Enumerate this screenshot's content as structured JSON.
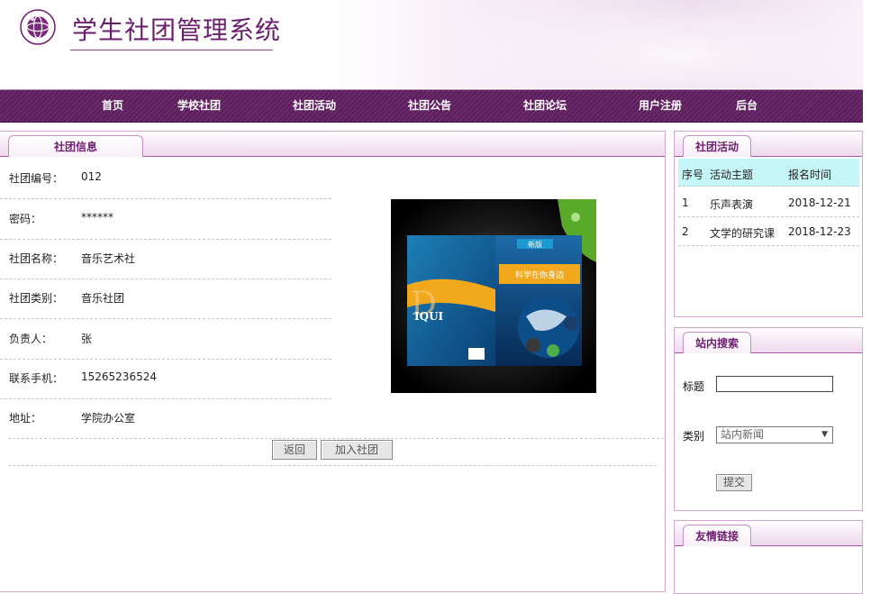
{
  "header": {
    "site_title": "学生社团管理系统"
  },
  "nav": [
    {
      "label": "首页"
    },
    {
      "label": "学校社团"
    },
    {
      "label": "社团活动"
    },
    {
      "label": "社团公告"
    },
    {
      "label": "社团论坛"
    },
    {
      "label": "用户注册"
    },
    {
      "label": "后台"
    }
  ],
  "club_info": {
    "tab_label": "社团信息",
    "fields": [
      {
        "label": "社团编号：",
        "value": "012"
      },
      {
        "label": "密码：",
        "value": "******"
      },
      {
        "label": "社团名称：",
        "value": "音乐艺术社"
      },
      {
        "label": "社团类别：",
        "value": "音乐社团"
      },
      {
        "label": "负责人：",
        "value": "张"
      },
      {
        "label": "联系手机：",
        "value": "15265236524"
      },
      {
        "label": "地址：",
        "value": "学院办公室"
      }
    ],
    "buttons": {
      "back": "返回",
      "join": "加入社团"
    }
  },
  "activities": {
    "tab_label": "社团活动",
    "columns": [
      "序号",
      "活动主题",
      "报名时间"
    ],
    "rows": [
      {
        "no": "1",
        "topic": "乐声表演",
        "date": "2018-12-21"
      },
      {
        "no": "2",
        "topic": "文学的研究课",
        "date": "2018-12-23"
      }
    ]
  },
  "search": {
    "tab_label": "站内搜索",
    "title_label": "标题",
    "title_value": "",
    "type_label": "类别",
    "type_selected": "站内新闻",
    "submit_label": "提交"
  },
  "links": {
    "tab_label": "友情链接"
  },
  "book_cover": {
    "badge": "新版",
    "title": "科学在你身边",
    "spine_text": "IQUI",
    "spine_letter": "D"
  },
  "colors": {
    "brand_purple": "#6c1e6e",
    "nav_bg": "#5a1f5b",
    "table_header_bg": "#c6f7f8"
  }
}
